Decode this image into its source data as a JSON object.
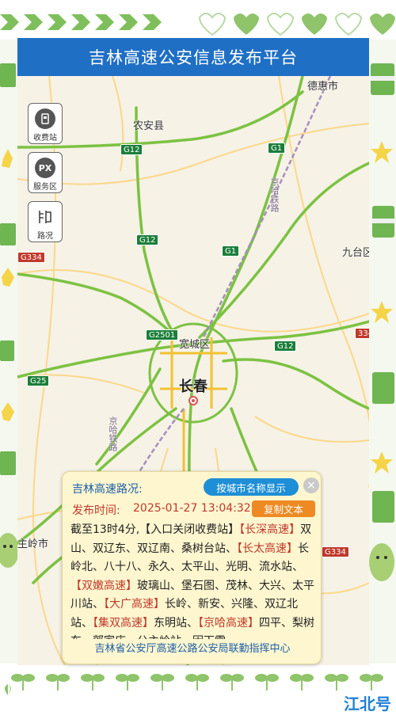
{
  "header": {
    "title": "吉林高速公安信息发布平台"
  },
  "map": {
    "cities": [
      {
        "name": "德惠市"
      },
      {
        "name": "农安县"
      },
      {
        "name": "九台区"
      },
      {
        "name": "宽城区"
      },
      {
        "name": "长春"
      },
      {
        "name": "主岭市"
      }
    ],
    "route_shields": [
      "G12",
      "G1",
      "G12",
      "G1",
      "G2501",
      "G12",
      "G25",
      "G334",
      "G334",
      "334"
    ],
    "railways": [
      "京哈铁路",
      "京哈铁路"
    ]
  },
  "tools": [
    {
      "label": "收费站",
      "icon": "toll-station-icon"
    },
    {
      "label": "服务区",
      "icon": "service-area-icon",
      "glyph": "PX"
    },
    {
      "label": "路况",
      "icon": "road-condition-icon"
    }
  ],
  "panel": {
    "title": "吉林高速路况:",
    "city_button": "按城市名称显示",
    "close_glyph": "×",
    "time_label": "发布时间:",
    "time_value": "2025-01-27 13:04:32",
    "copy_button": "复制文本",
    "report": {
      "intro": "截至13时4分,【入口关闭收费站】",
      "segments": [
        {
          "highway": "【长深高速】",
          "stations": "双山、双辽东、双辽南、桑树台站、"
        },
        {
          "highway": "【长太高速】",
          "stations": "长岭北、八十八、永久、太平山、光明、流水站、"
        },
        {
          "highway": "【双嫩高速】",
          "stations": "玻璃山、堡石图、茂林、大兴、太平川站、"
        },
        {
          "highway": "【大广高速】",
          "stations": "长岭、新安、兴隆、双辽北站、"
        },
        {
          "highway": "【集双高速】",
          "stations": "东明站、"
        },
        {
          "highway": "【京哈高速】",
          "stations": "四平、梨树东、郭家店、公主岭站、因下雪"
        }
      ]
    },
    "footer": "吉林省公安厅高速公路公安局联勤指挥中心"
  },
  "watermark": "江北号",
  "colors": {
    "header_bg": "#1f6fc5",
    "highway_green": "#7cc242",
    "panel_bg": "#fdf6cf",
    "alert_red": "#c0392b",
    "button_blue": "#1e8fd6",
    "button_orange": "#ee8a23"
  }
}
